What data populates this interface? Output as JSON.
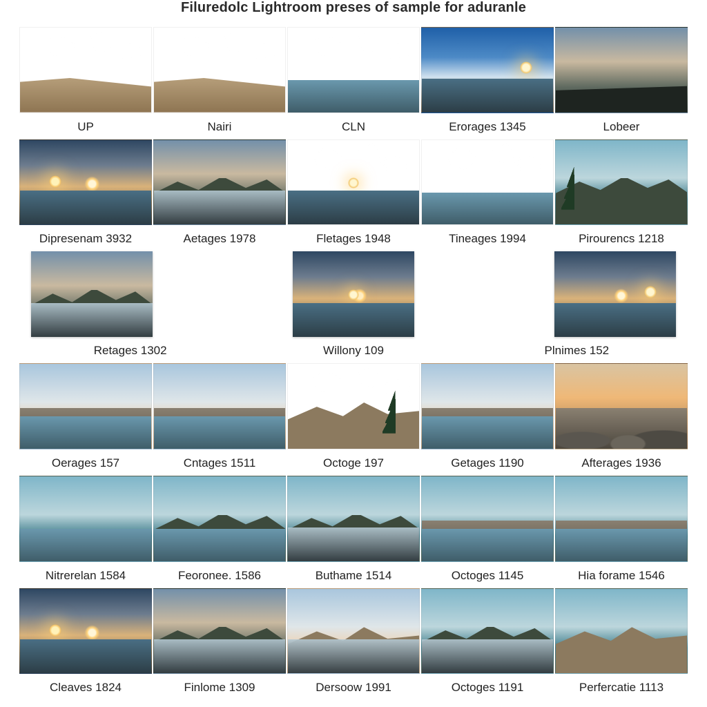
{
  "title": "Filuredolc Lightroom preses of sample for aduranle",
  "rows": [
    {
      "cols": 5,
      "labels": [
        "UP",
        "Nairi",
        "CLN",
        "Erorages 1345",
        "Lobeer"
      ]
    },
    {
      "cols": 5,
      "labels": [
        "Dipresenam 3932",
        "Aetages 1978",
        "Fletages 1948",
        "Tineages 1994",
        "Pirourencs 1218"
      ]
    },
    {
      "cols": 3,
      "labels": [
        "Retages 1302",
        "Willony 109",
        "Plnimes 152"
      ]
    },
    {
      "cols": 5,
      "labels": [
        "Oerages 157",
        "Cntages 1511",
        "Octoge 197",
        "Getages 1190",
        "Afterages 1936"
      ]
    },
    {
      "cols": 5,
      "labels": [
        "Nitrerelan 1584",
        "Feoronee. 1586",
        "Buthame 1514",
        "Octoges 1145",
        "Hia forame 1546"
      ]
    },
    {
      "cols": 5,
      "labels": [
        "Cleaves 1824",
        "Finlome 1309",
        "Dersoow 1991",
        "Octoges 1191",
        "Perfercatie 1113"
      ]
    }
  ],
  "thumb_styles": [
    [
      "sky-soft sand clouds",
      "sky-soft sand clouds",
      "sky-soft sea-light clouds",
      "sky-blue sea sun-r",
      "sky-dusk dark-fg"
    ],
    [
      "sky-sunset sea sun-low",
      "sky-dusk mtn reflect",
      "sky-sunset sea sun-c clouds",
      "sky-soft sea-light clouds",
      "sky-teal mtn pine reflect"
    ],
    [
      "sky-dusk mtn reflect",
      "sky-sunset sea sun-c",
      "sky-sunset sea sun-r"
    ],
    [
      "sky-soft rocks sea-light",
      "sky-soft rocks sea-light",
      "sky-blue mtn-bare clouds pine",
      "sky-soft rocks sea-light",
      "grad-warm rocks"
    ],
    [
      "sky-teal sea-light",
      "sky-teal mtn sea-light",
      "sky-teal mtn reflect",
      "sky-teal rocks sea-light",
      "sky-teal rocks sea-light"
    ],
    [
      "sky-sunset sea sun-low rocks",
      "sky-dusk mtn reflect",
      "sky-soft mtn-bare reflect",
      "sky-teal mtn reflect rocks",
      "sky-teal mtn-bare rocks"
    ]
  ]
}
